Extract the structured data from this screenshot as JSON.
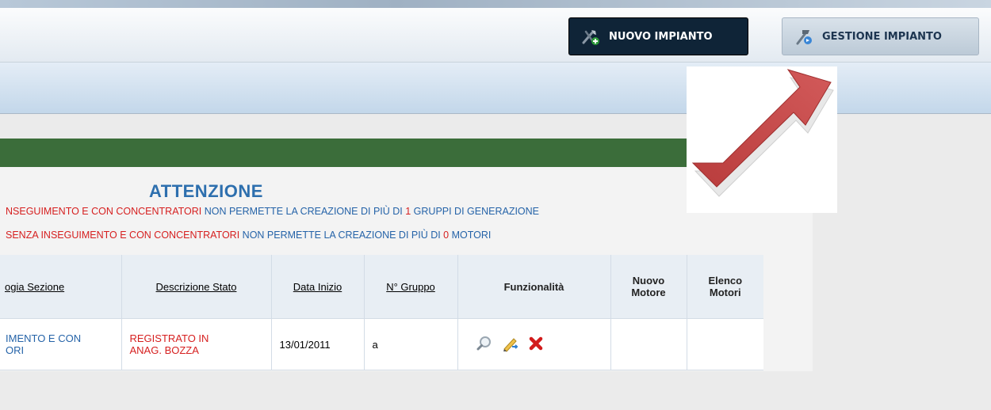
{
  "header": {
    "new_plant_label": "NUOVO IMPIANTO",
    "manage_plant_label": "GESTIONE IMPIANTO"
  },
  "notice": {
    "title": "ATTENZIONE",
    "line1_red": "NSEGUIMENTO E CON CONCENTRATORI",
    "line1_blue_a": " NON PERMETTE LA CREAZIONE DI PIÙ DI ",
    "line1_num": "1",
    "line1_blue_b": " GRUPPI DI GENERAZIONE",
    "line2_red": "SENZA INSEGUIMENTO E CON CONCENTRATORI",
    "line2_blue_a": " NON PERMETTE LA CREAZIONE DI PIÙ DI ",
    "line2_num": "0",
    "line2_blue_b": " MOTORI"
  },
  "table": {
    "headers": {
      "tipologia": "ogia Sezione",
      "stato": "Descrizione Stato",
      "data_inizio": "Data Inizio",
      "gruppo": "N° Gruppo",
      "funzionalita": "Funzionalità",
      "nuovo_motore_1": "Nuovo",
      "nuovo_motore_2": "Motore",
      "elenco_motori_1": "Elenco",
      "elenco_motori_2": "Motori"
    },
    "rows": [
      {
        "tipologia_1": "IMENTO E CON",
        "tipologia_2": "ORI",
        "stato_1": "REGISTRATO IN",
        "stato_2": "ANAG. BOZZA",
        "data_inizio": "13/01/2011",
        "gruppo": "a"
      }
    ]
  },
  "icons": {
    "new_plant": "tools-add-icon",
    "manage_plant": "hammer-settings-icon",
    "view": "magnifier-icon",
    "edit": "pencil-edit-icon",
    "delete": "red-x-icon",
    "overlay_arrow": "red-arrow-icon"
  },
  "colors": {
    "green_bar": "#3b6d3a",
    "accent_blue": "#2563a8",
    "accent_red": "#d61f1f",
    "arrow_red": "#c44545"
  }
}
